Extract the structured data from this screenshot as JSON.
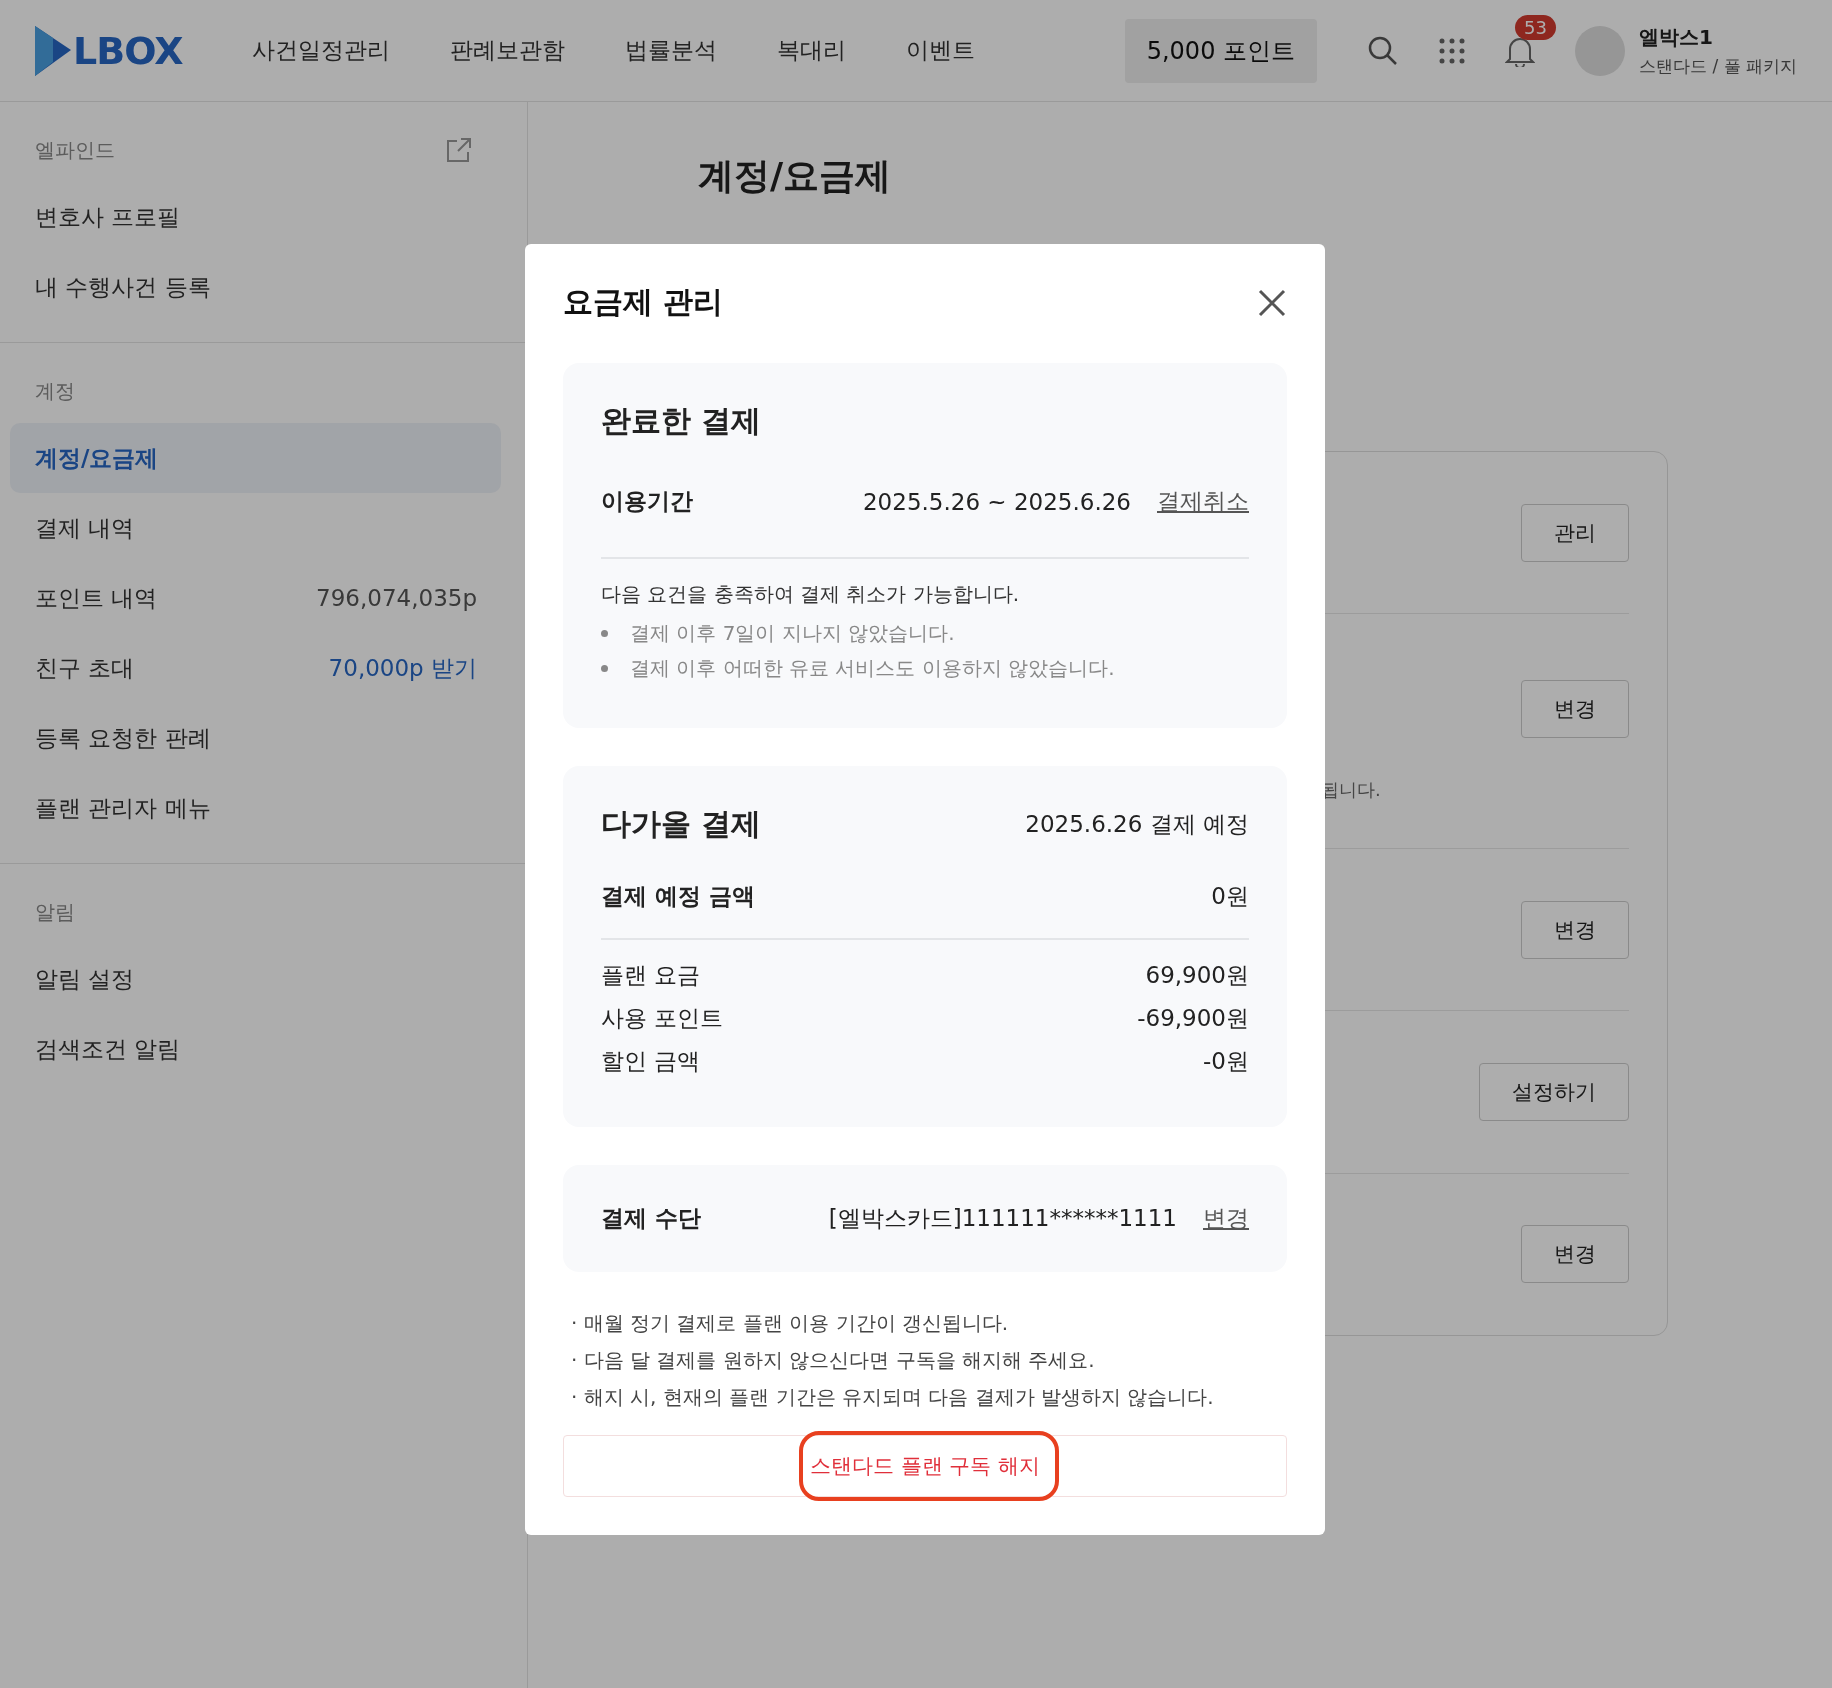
{
  "header": {
    "logo": "LBOX",
    "nav": [
      "사건일정관리",
      "판례보관함",
      "법률분석",
      "복대리",
      "이벤트"
    ],
    "points_button": "5,000 포인트",
    "notification_count": "53",
    "user": {
      "name": "엘박스1",
      "plan": "스탠다드 / 풀 패키지"
    }
  },
  "sidebar": {
    "sections": [
      {
        "title": "엘파인드",
        "external_link": true,
        "items": [
          {
            "label": "변호사 프로필",
            "selected": false
          },
          {
            "label": "내 수행사건 등록",
            "selected": false
          }
        ]
      },
      {
        "title": "계정",
        "external_link": false,
        "items": [
          {
            "label": "계정/요금제",
            "selected": true
          },
          {
            "label": "결제 내역",
            "selected": false
          },
          {
            "label": "포인트 내역",
            "value": "796,074,035p",
            "kind": "plain",
            "selected": false
          },
          {
            "label": "친구 초대",
            "value": "70,000p 받기",
            "kind": "link",
            "selected": false
          },
          {
            "label": "등록 요청한 판례",
            "selected": false
          },
          {
            "label": "플랜 관리자 메뉴",
            "selected": false
          }
        ]
      },
      {
        "title": "알림",
        "external_link": false,
        "items": [
          {
            "label": "알림 설정",
            "selected": false
          },
          {
            "label": "검색조건 알림",
            "selected": false
          }
        ]
      }
    ]
  },
  "page_title": "계정/요금제",
  "background_card": {
    "rows": [
      {
        "button": "관리"
      },
      {
        "button": "변경",
        "text": "됩니다."
      },
      {
        "button": "변경"
      },
      {
        "button": "설정하기"
      },
      {
        "button": "변경"
      }
    ]
  },
  "modal": {
    "title": "요금제 관리",
    "completed": {
      "heading": "완료한 결제",
      "period_label": "이용기간",
      "period_value": "2025.5.26 ~ 2025.6.26",
      "cancel_link": "결제취소",
      "notice": "다음 요건을 충족하여 결제 취소가 가능합니다.",
      "conditions": [
        "결제 이후 7일이 지나지 않았습니다.",
        "결제 이후 어떠한 유료 서비스도 이용하지 않았습니다."
      ]
    },
    "upcoming": {
      "heading": "다가올 결제",
      "scheduled": "2025.6.26 결제 예정",
      "total_label": "결제 예정 금액",
      "total_value": "0원",
      "lines": [
        {
          "label": "플랜 요금",
          "value": "69,900원"
        },
        {
          "label": "사용 포인트",
          "value": "-69,900원"
        },
        {
          "label": "할인 금액",
          "value": "-0원"
        }
      ]
    },
    "payment_method": {
      "label": "결제 수단",
      "value": "[엘박스카드]111111******1111",
      "change_link": "변경"
    },
    "notes": [
      "· 매월 정기 결제로 플랜 이용 기간이 갱신됩니다.",
      "· 다음 달 결제를 원하지 않으신다면 구독을 해지해 주세요.",
      "· 해지 시, 현재의 플랜 기간은 유지되며 다음 결제가 발생하지 않습니다."
    ],
    "cancel_button": {
      "label": "스탠다드 플랜 구독 해지",
      "highlighted": true
    }
  }
}
